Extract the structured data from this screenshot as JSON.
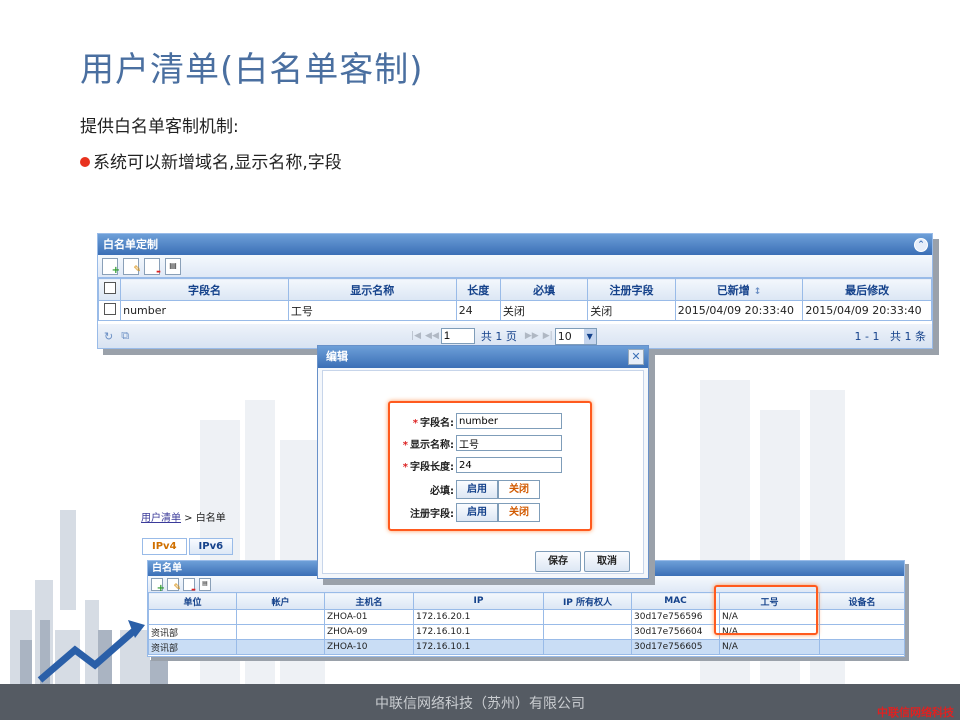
{
  "slide": {
    "title": "用户清单(白名单客制)",
    "subtitle": "提供白名单客制机制:",
    "bullet": "系统可以新增域名,显示名称,字段",
    "footer": "中联信网络科技（苏州）有限公司",
    "footer_logo": "中联信网络科技"
  },
  "panel1": {
    "title": "白名单定制",
    "columns": [
      "字段名",
      "显示名称",
      "长度",
      "必填",
      "注册字段",
      "已新增",
      "最后修改"
    ],
    "sort_indicator": "↕",
    "rows": [
      {
        "field": "number",
        "display": "工号",
        "length": "24",
        "required": "关闭",
        "register": "关闭",
        "created": "2015/04/09 20:33:40",
        "modified": "2015/04/09 20:33:40"
      }
    ],
    "pager": {
      "page_value": "1",
      "total_pages": "共 1 页",
      "page_size": "10",
      "range": "1 - 1",
      "total": "共 1 条"
    }
  },
  "dialog": {
    "title": "编辑",
    "labels": {
      "field_name": "字段名:",
      "display_name": "显示名称:",
      "length": "字段长度:",
      "required": "必填:",
      "register": "注册字段:"
    },
    "values": {
      "field_name": "number",
      "display_name": "工号",
      "length": "24"
    },
    "toggle_on": "启用",
    "toggle_off": "关闭",
    "save": "保存",
    "cancel": "取消"
  },
  "panel2": {
    "breadcrumb_link": "用户清单",
    "breadcrumb_sep": " > ",
    "breadcrumb_current": "白名单",
    "tabs": [
      "IPv4",
      "IPv6"
    ],
    "title": "白名单",
    "columns": [
      "单位",
      "帐户",
      "主机名",
      "IP",
      "IP 所有权人",
      "MAC",
      "工号",
      "设备名"
    ],
    "rows": [
      [
        "",
        "",
        "ZHOA-01",
        "172.16.20.1",
        "",
        "30d17e756596",
        "N/A",
        ""
      ],
      [
        "资讯部",
        "",
        "ZHOA-09",
        "172.16.10.1",
        "",
        "30d17e756604",
        "N/A",
        ""
      ],
      [
        "资讯部",
        "",
        "ZHOA-10",
        "172.16.10.1",
        "",
        "30d17e756605",
        "N/A",
        ""
      ]
    ]
  },
  "colors": {
    "title": "#4a6fa0",
    "header_blue": "#3b6fb6",
    "highlight": "#ff5a1e",
    "footer_bg": "#555b63"
  }
}
